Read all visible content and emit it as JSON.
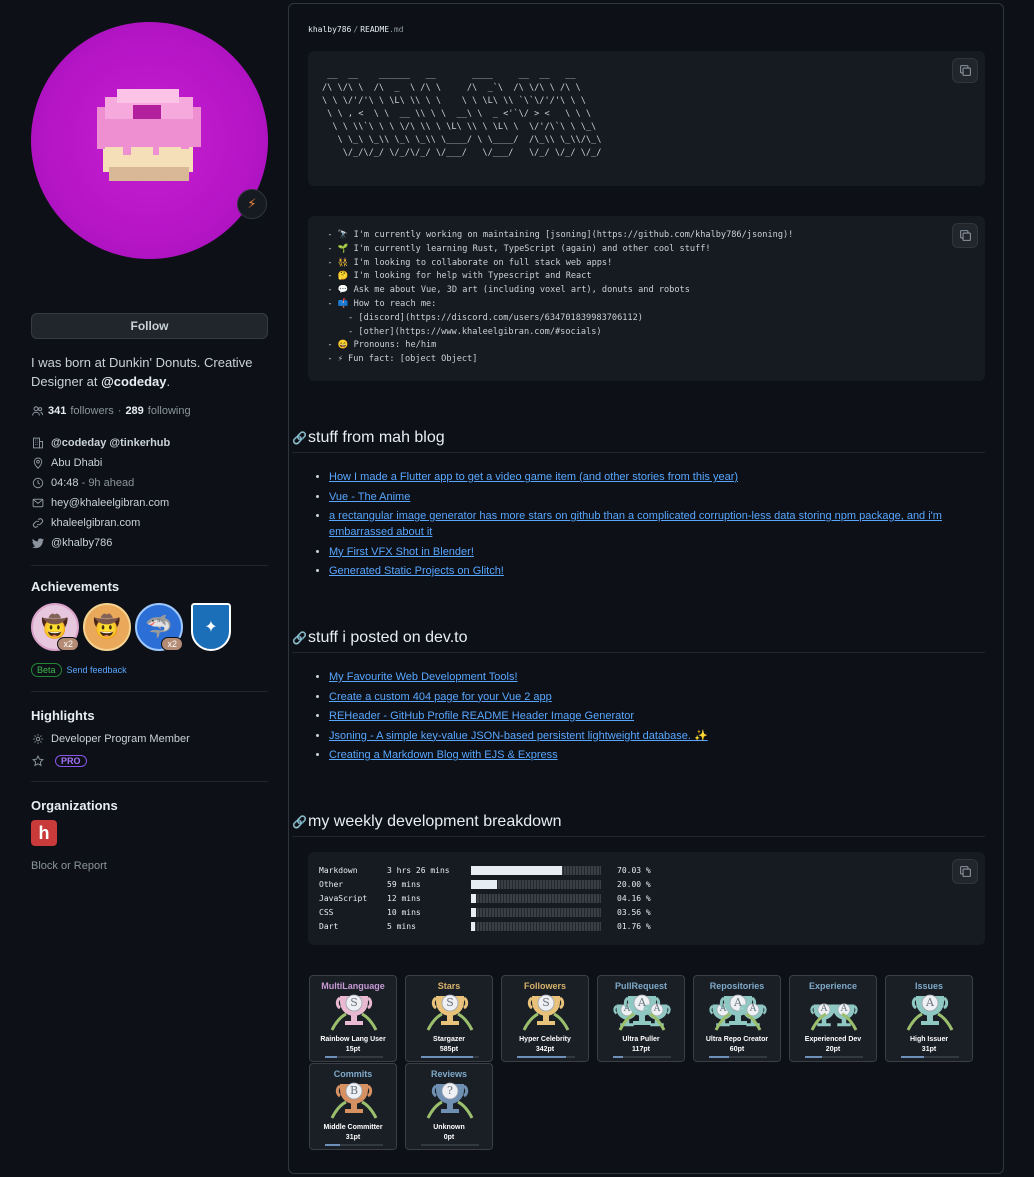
{
  "profile": {
    "follow_label": "Follow",
    "bio_pre": "I was born at Dunkin' Donuts. Creative Designer at ",
    "bio_handle": "@codeday",
    "bio_post": ".",
    "followers_count": "341",
    "followers_label": "followers",
    "dot": "·",
    "following_count": "289",
    "following_label": "following",
    "orgs_text": "@codeday @tinkerhub",
    "location": "Abu Dhabi",
    "time": "04:48",
    "time_note": "- 9h ahead",
    "email": "hey@khaleelgibran.com",
    "website": "khaleelgibran.com",
    "twitter": "@khalby786",
    "status_icon": "⚡"
  },
  "achievements": {
    "title": "Achievements",
    "items": [
      {
        "icon": "🤠",
        "count": "x2",
        "bg": "#e8c9e0"
      },
      {
        "icon": "🤠",
        "count": "",
        "bg": "#e9a85a"
      },
      {
        "icon": "🦈",
        "count": "x2",
        "bg": "#2b6fd6"
      },
      {
        "icon": "✦",
        "count": "",
        "bg": "#1b6fb8"
      }
    ],
    "beta_label": "Beta",
    "feedback_label": "Send feedback"
  },
  "highlights": {
    "title": "Highlights",
    "dev_program": "Developer Program Member",
    "pro_label": "PRO"
  },
  "organizations": {
    "title": "Organizations",
    "org_letter": "h",
    "block_label": "Block or Report"
  },
  "readme": {
    "user": "khalby786",
    "sep": "/",
    "file": "README",
    "ext": ".md",
    "ascii": " __  __    ______   __       ____     __  __   __    \n/\\ \\/\\ \\  /\\  _  \\ /\\ \\     /\\  _`\\  /\\ \\/\\ \\ /\\ \\   \n\\ \\ \\/'/'\\ \\ \\L\\ \\\\ \\ \\    \\ \\ \\L\\ \\\\ `\\`\\/'/'\\ \\ \\  \n \\ \\ , <  \\ \\  __ \\\\ \\ \\  __\\ \\  _ <'`\\/ > <   \\ \\ \\ \n  \\ \\ \\\\`\\ \\ \\ \\/\\ \\\\ \\ \\L\\ \\\\ \\ \\L\\ \\  \\/'/\\`\\ \\ \\_\\\n   \\ \\_\\ \\_\\\\ \\_\\ \\_\\\\ \\____/ \\ \\____/  /\\_\\\\ \\_\\\\/\\_\\\n    \\/_/\\/_/ \\/_/\\/_/ \\/___/   \\/___/   \\/_/ \\/_/ \\/_/",
    "intro": "  - 🔭 I'm currently working on maintaining [jsoning](https://github.com/khalby786/jsoning)!\n  - 🌱 I'm currently learning Rust, TypeScript (again) and other cool stuff!\n  - 👯 I'm looking to collaborate on full stack web apps!\n  - 🤔 I'm looking for help with Typescript and React\n  - 💬 Ask me about Vue, 3D art (including voxel art), donuts and robots\n  - 📫 How to reach me:\n      - [discord](https://discord.com/users/634701839983706112)\n      - [other](https://www.khaleelgibran.com/#socials)\n  - 😄 Pronouns: he/him\n  - ⚡ Fun fact: [object Object]",
    "blog_heading": "stuff from mah blog",
    "blog_posts": [
      "How I made a Flutter app to get a video game item (and other stories from this year)",
      "Vue - The Anime",
      "a rectangular image generator has more stars on github than a complicated corruption-less data storing npm package, and i'm embarrassed about it",
      "My First VFX Shot in Blender!",
      "Generated Static Projects on Glitch!"
    ],
    "devto_heading": "stuff i posted on dev.to",
    "devto_posts": [
      "My Favourite Web Development Tools!",
      "Create a custom 404 page for your Vue 2 app",
      "REHeader - GitHub Profile README Header Image Generator",
      "Jsoning - A simple key-value JSON-based persistent lightweight database. ✨",
      "Creating a Markdown Blog with EJS & Express"
    ],
    "weekly_heading": "my weekly development breakdown",
    "languages": [
      {
        "name": "Markdown",
        "time": "3 hrs 26 mins",
        "percent": "70.03 %",
        "fraction": 0.7003
      },
      {
        "name": "Other",
        "time": "59 mins",
        "percent": "20.00 %",
        "fraction": 0.2
      },
      {
        "name": "JavaScript",
        "time": "12 mins",
        "percent": "04.16 %",
        "fraction": 0.0416
      },
      {
        "name": "CSS",
        "time": "10 mins",
        "percent": "03.56 %",
        "fraction": 0.0356
      },
      {
        "name": "Dart",
        "time": "5 mins",
        "percent": "01.76 %",
        "fraction": 0.0176
      }
    ]
  },
  "trophies": [
    {
      "title": "MultiLanguage",
      "rank": "S",
      "name": "Rainbow Lang User",
      "pts": "15pt",
      "progress": 0.2,
      "color": "#c79ad5",
      "cup": "#e9b9d2"
    },
    {
      "title": "Stars",
      "rank": "S",
      "name": "Stargazer",
      "pts": "585pt",
      "progress": 0.9,
      "color": "#d7b36b",
      "cup": "#e8c27a"
    },
    {
      "title": "Followers",
      "rank": "S",
      "name": "Hyper Celebrity",
      "pts": "342pt",
      "progress": 0.85,
      "color": "#d7b36b",
      "cup": "#e8c27a"
    },
    {
      "title": "PullRequest",
      "rank": "AAA",
      "name": "Ultra Puller",
      "pts": "117pt",
      "progress": 0.18,
      "color": "#7fa9c8",
      "cup": "#8fc7c2"
    },
    {
      "title": "Repositories",
      "rank": "AAA",
      "name": "Ultra Repo Creator",
      "pts": "60pt",
      "progress": 0.35,
      "color": "#7fa9c8",
      "cup": "#8fc7c2"
    },
    {
      "title": "Experience",
      "rank": "AA",
      "name": "Experienced Dev",
      "pts": "20pt",
      "progress": 0.3,
      "color": "#7fa9c8",
      "cup": "#8fc7c2"
    },
    {
      "title": "Issues",
      "rank": "A",
      "name": "High Issuer",
      "pts": "31pt",
      "progress": 0.4,
      "color": "#7fa9c8",
      "cup": "#8fc7c2"
    },
    {
      "title": "Commits",
      "rank": "B",
      "name": "Middle Committer",
      "pts": "31pt",
      "progress": 0.25,
      "color": "#7fa9c8",
      "cup": "#d79061"
    },
    {
      "title": "Reviews",
      "rank": "?",
      "name": "Unknown",
      "pts": "0pt",
      "progress": 0,
      "color": "#7fa9c8",
      "cup": "#6f8fb3"
    }
  ]
}
